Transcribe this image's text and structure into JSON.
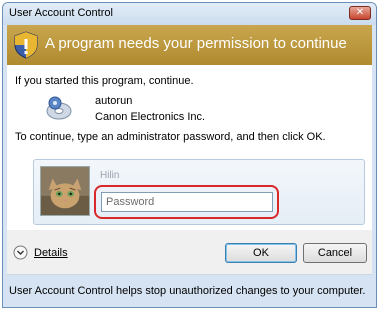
{
  "window": {
    "title": "User Account Control",
    "close_label": "✕"
  },
  "banner": {
    "text": "A program needs your permission to continue"
  },
  "content": {
    "line1": "If you started this program, continue.",
    "program_name": "autorun",
    "publisher": "Canon Electronics Inc.",
    "line2": "To continue, type an administrator password, and then click OK."
  },
  "credentials": {
    "user_name": "Hilin",
    "password_placeholder": "Password"
  },
  "footer": {
    "details_label": "Details",
    "ok_label": "OK",
    "cancel_label": "Cancel",
    "bottom_text": "User Account Control helps stop unauthorized changes to your computer."
  },
  "colors": {
    "banner": "#b8922f",
    "highlight": "#d8282a"
  },
  "icons": [
    "shield-icon",
    "program-disc-icon",
    "user-avatar-cat",
    "chevron-down-icon",
    "close-icon"
  ]
}
